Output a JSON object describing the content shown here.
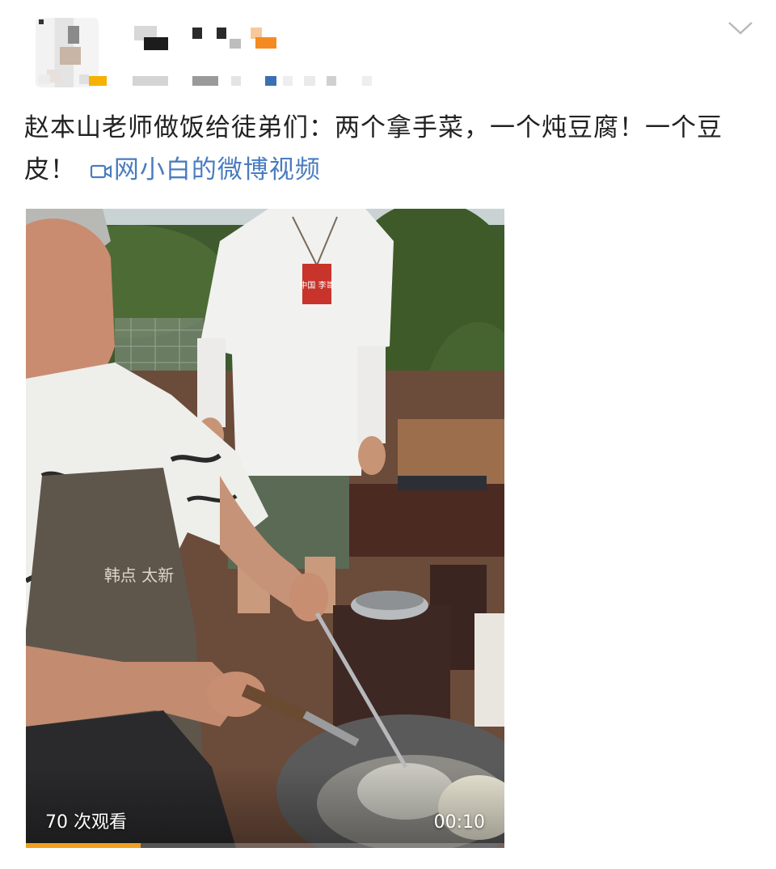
{
  "post": {
    "text": "赵本山老师做饭给徒弟们：两个拿手菜，一个炖豆腐！一个豆皮！",
    "video_link_label": "网小白的微博视频",
    "link_icon": "video-camera-icon",
    "menu_icon": "chevron-down-icon"
  },
  "video": {
    "view_count_label": "70 次观看",
    "duration_label": "00:10",
    "progress_fraction": 0.24,
    "apron_text": "韩点 太新",
    "badge_text": "中国 李哥"
  },
  "colors": {
    "link": "#4a7cbf",
    "text": "#222222",
    "progress": "#f0a020"
  }
}
